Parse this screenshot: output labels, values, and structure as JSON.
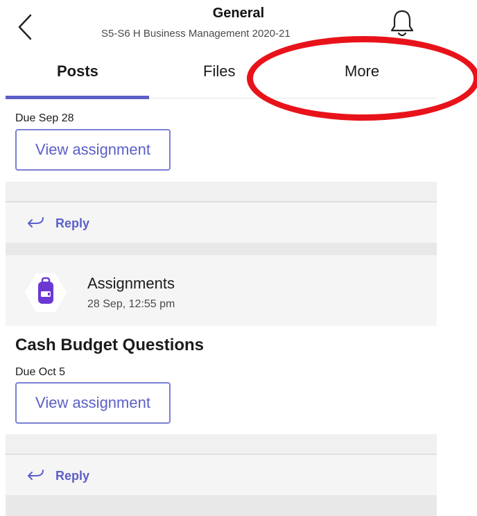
{
  "header": {
    "title": "General",
    "subtitle": "S5-S6 H Business Management 2020-21",
    "back_icon": "chevron-left-icon",
    "bell_icon": "bell-icon"
  },
  "tabs": [
    {
      "label": "Posts",
      "active": true
    },
    {
      "label": "Files",
      "active": false
    },
    {
      "label": "More",
      "active": false
    }
  ],
  "colors": {
    "accent": "#5b5fc7",
    "annotation": "#e8131a",
    "assignments_icon": "#6b38d4"
  },
  "posts": [
    {
      "due": "Due Sep 28",
      "button_label": "View assignment",
      "reply_label": "Reply"
    },
    {
      "app_name": "Assignments",
      "app_icon": "backpack-icon",
      "timestamp": "28 Sep, 12:55 pm",
      "title": "Cash Budget Questions",
      "due": "Due Oct 5",
      "button_label": "View assignment",
      "reply_label": "Reply"
    }
  ]
}
